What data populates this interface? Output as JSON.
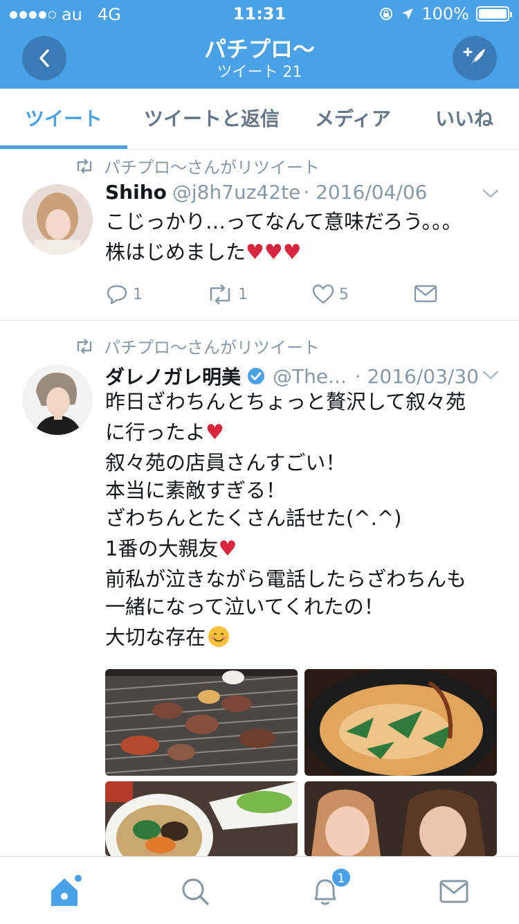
{
  "status_bar": {
    "carrier": "au",
    "network": "4G",
    "time": "11:31",
    "battery": "100%"
  },
  "header": {
    "title": "パチプロ〜",
    "subtitle": "ツイート 21"
  },
  "tabs": [
    {
      "label": "ツイート",
      "active": true
    },
    {
      "label": "ツイートと返信",
      "active": false
    },
    {
      "label": "メディア",
      "active": false
    },
    {
      "label": "いいね",
      "active": false
    }
  ],
  "tweets": [
    {
      "retweet_label": "パチプロ〜さんがリツイート",
      "name": "Shiho",
      "handle": "@j8h7uz42te",
      "date": "· 2016/04/06",
      "text_lines": [
        "こじっかり…ってなんて意味だろう。。。",
        "株はじめました"
      ],
      "replies": "1",
      "retweets": "1",
      "likes": "5"
    },
    {
      "retweet_label": "パチプロ〜さんがリツイート",
      "name": "ダレノガレ明美",
      "handle": "@The...",
      "date": "· 2016/03/30",
      "text_lines": [
        "昨日ざわちんとちょっと贅沢して叙々苑",
        "に行ったよ",
        "叙々苑の店員さんすごい！",
        "本当に素敵すぎる！",
        "ざわちんとたくさん話せた(^.^)",
        "1番の大親友",
        "前私が泣きながら電話したらざわちんも",
        "一緒になって泣いてくれたの！",
        "大切な存在"
      ]
    }
  ],
  "bottom_bar": {
    "notification_count": "1"
  },
  "colors": {
    "accent": "#4aa1e6",
    "header_button": "#3a7bb5",
    "heart": "#d7263d"
  }
}
